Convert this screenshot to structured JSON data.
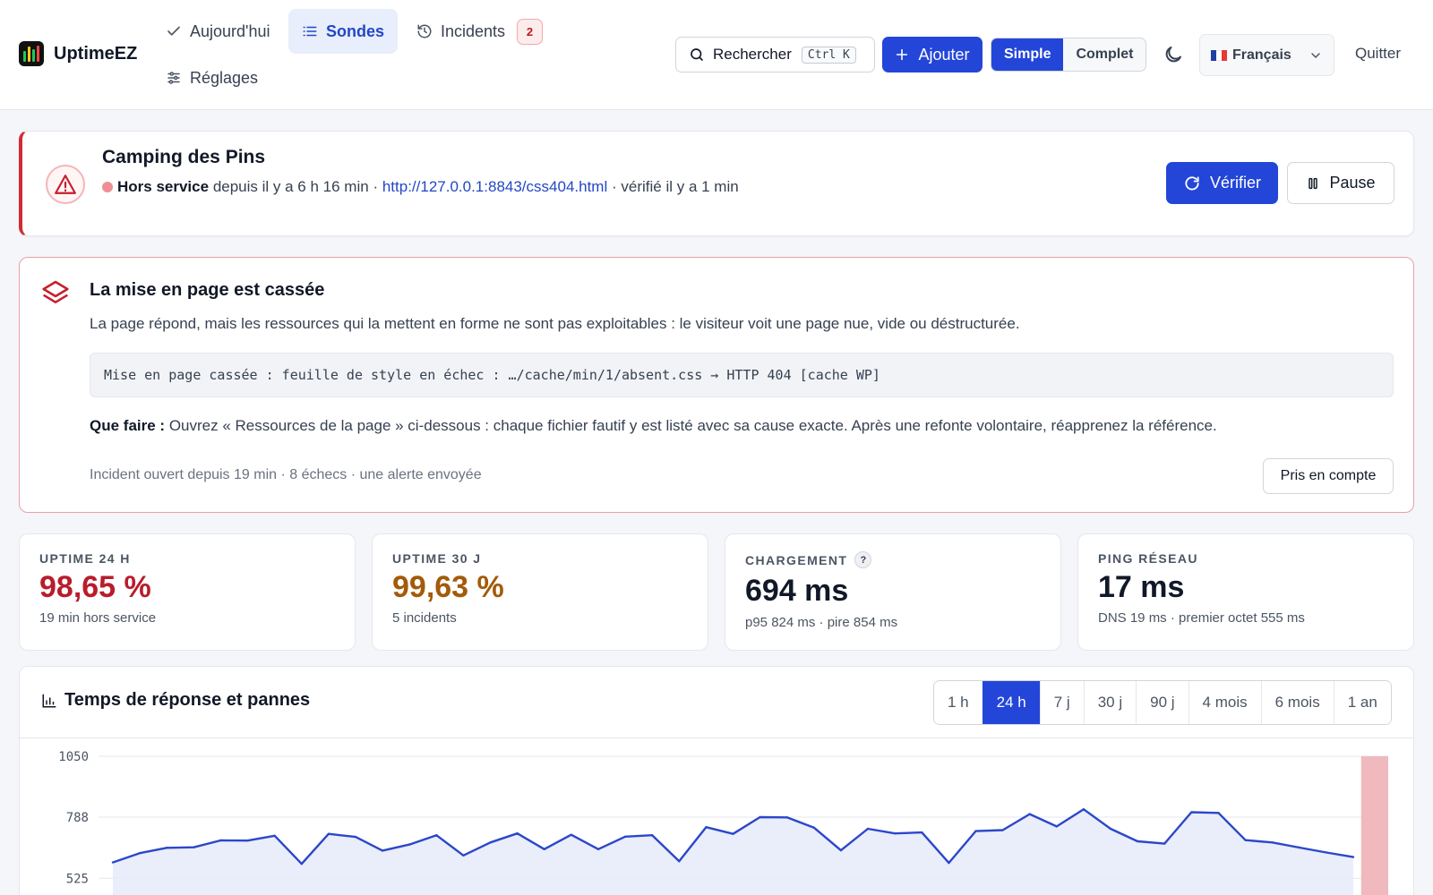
{
  "header": {
    "app_name": "UptimeEZ",
    "nav": [
      {
        "label": "Aujourd'hui",
        "icon": "check-icon",
        "active": false
      },
      {
        "label": "Sondes",
        "icon": "list-icon",
        "active": true
      },
      {
        "label": "Incidents",
        "icon": "history-icon",
        "active": false,
        "badge": "2"
      },
      {
        "label": "Réglages",
        "icon": "sliders-icon",
        "active": false
      }
    ],
    "search": {
      "label": "Rechercher",
      "shortcut": "Ctrl K"
    },
    "add_label": "Ajouter",
    "modes": [
      "Simple",
      "Complet"
    ],
    "active_mode": "Simple",
    "language": "Français",
    "quit_label": "Quitter"
  },
  "status": {
    "monitor_name": "Camping des Pins",
    "state": "Hors service",
    "since": "depuis il y a 6 h 16 min",
    "separator": "·",
    "url": "http://127.0.0.1:8843/css404.html",
    "checked": "vérifié il y a 1 min",
    "verify_label": "Vérifier",
    "pause_label": "Pause"
  },
  "incident": {
    "title": "La mise en page est cassée",
    "description": "La page répond, mais les ressources qui la mettent en forme ne sont pas exploitables : le visiteur voit une page nue, vide ou déstructurée.",
    "detail": "Mise en page cassée : feuille de style en échec : …/cache/min/1/absent.css → HTTP 404 [cache WP]",
    "todo_label": "Que faire :",
    "todo_text": "Ouvrez « Ressources de la page » ci-dessous : chaque fichier fautif y est listé avec sa cause exacte. Après une refonte volontaire, réapprenez la référence.",
    "meta": "Incident ouvert depuis 19 min · 8 échecs · une alerte envoyée",
    "ack_label": "Pris en compte"
  },
  "metrics": [
    {
      "label": "UPTIME 24 H",
      "value": "98,65 %",
      "sub": "19 min hors service",
      "color": "#b91c2c"
    },
    {
      "label": "UPTIME 30 J",
      "value": "99,63 %",
      "sub": "5 incidents",
      "color": "#a35a09"
    },
    {
      "label": "CHARGEMENT",
      "help": "?",
      "value": "694 ms",
      "sub": "p95 824 ms · pire 854 ms",
      "color": "#111827"
    },
    {
      "label": "PING RÉSEAU",
      "value": "17 ms",
      "sub": "DNS 19 ms · premier octet 555 ms",
      "color": "#111827"
    }
  ],
  "chart_section": {
    "title": "Temps de réponse et pannes",
    "ranges": [
      "1 h",
      "24 h",
      "7 j",
      "30 j",
      "90 j",
      "4 mois",
      "6 mois",
      "1 an"
    ],
    "active_range": "24 h"
  },
  "chart_data": {
    "type": "area",
    "y_ticks": [
      1050,
      788,
      525
    ],
    "ylim": [
      525,
      1050
    ],
    "values": [
      593,
      633,
      656,
      658,
      688,
      687,
      708,
      587,
      716,
      703,
      644,
      670,
      710,
      623,
      679,
      718,
      650,
      712,
      650,
      704,
      710,
      598,
      745,
      716,
      788,
      787,
      743,
      645,
      738,
      718,
      722,
      591,
      728,
      732,
      801,
      748,
      822,
      738,
      684,
      674,
      809,
      806,
      689,
      679,
      657,
      636,
      616
    ],
    "outage": {
      "start_fraction": 0.979,
      "end_fraction": 1.0
    },
    "colors": {
      "line": "#2b47c9",
      "fill": "#e8ebf9",
      "outage": "#efb9bd",
      "grid": "#e5e7eb"
    }
  }
}
